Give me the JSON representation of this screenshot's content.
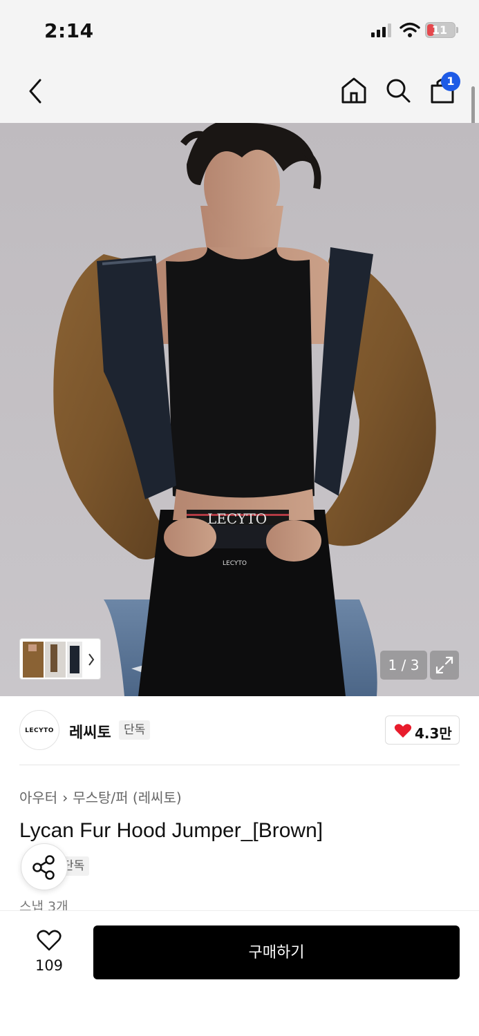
{
  "status": {
    "time": "2:14",
    "battery": "11"
  },
  "nav": {
    "cart_count": "1"
  },
  "gallery": {
    "counter": "1 / 3",
    "current": 1,
    "total": 3,
    "print_text": "LECYTO",
    "belt_text": "LECYTO"
  },
  "brand": {
    "logo_text": "LECYTO",
    "name": "레씨토",
    "tag": "단독",
    "likes": "4.3만"
  },
  "breadcrumb": {
    "category": "아우터",
    "subcategory": "무스탕/퍼 (레씨토)"
  },
  "product": {
    "title": "Lycan Fur Hood Jumper_[Brown]",
    "tag": "단독",
    "snap": "스냅 3개"
  },
  "bottom": {
    "wish_count": "109",
    "buy_label": "구매하기"
  },
  "colors": {
    "accent_badge": "#1e5be6",
    "heart": "#e81c2c",
    "buy_button": "#000000"
  }
}
